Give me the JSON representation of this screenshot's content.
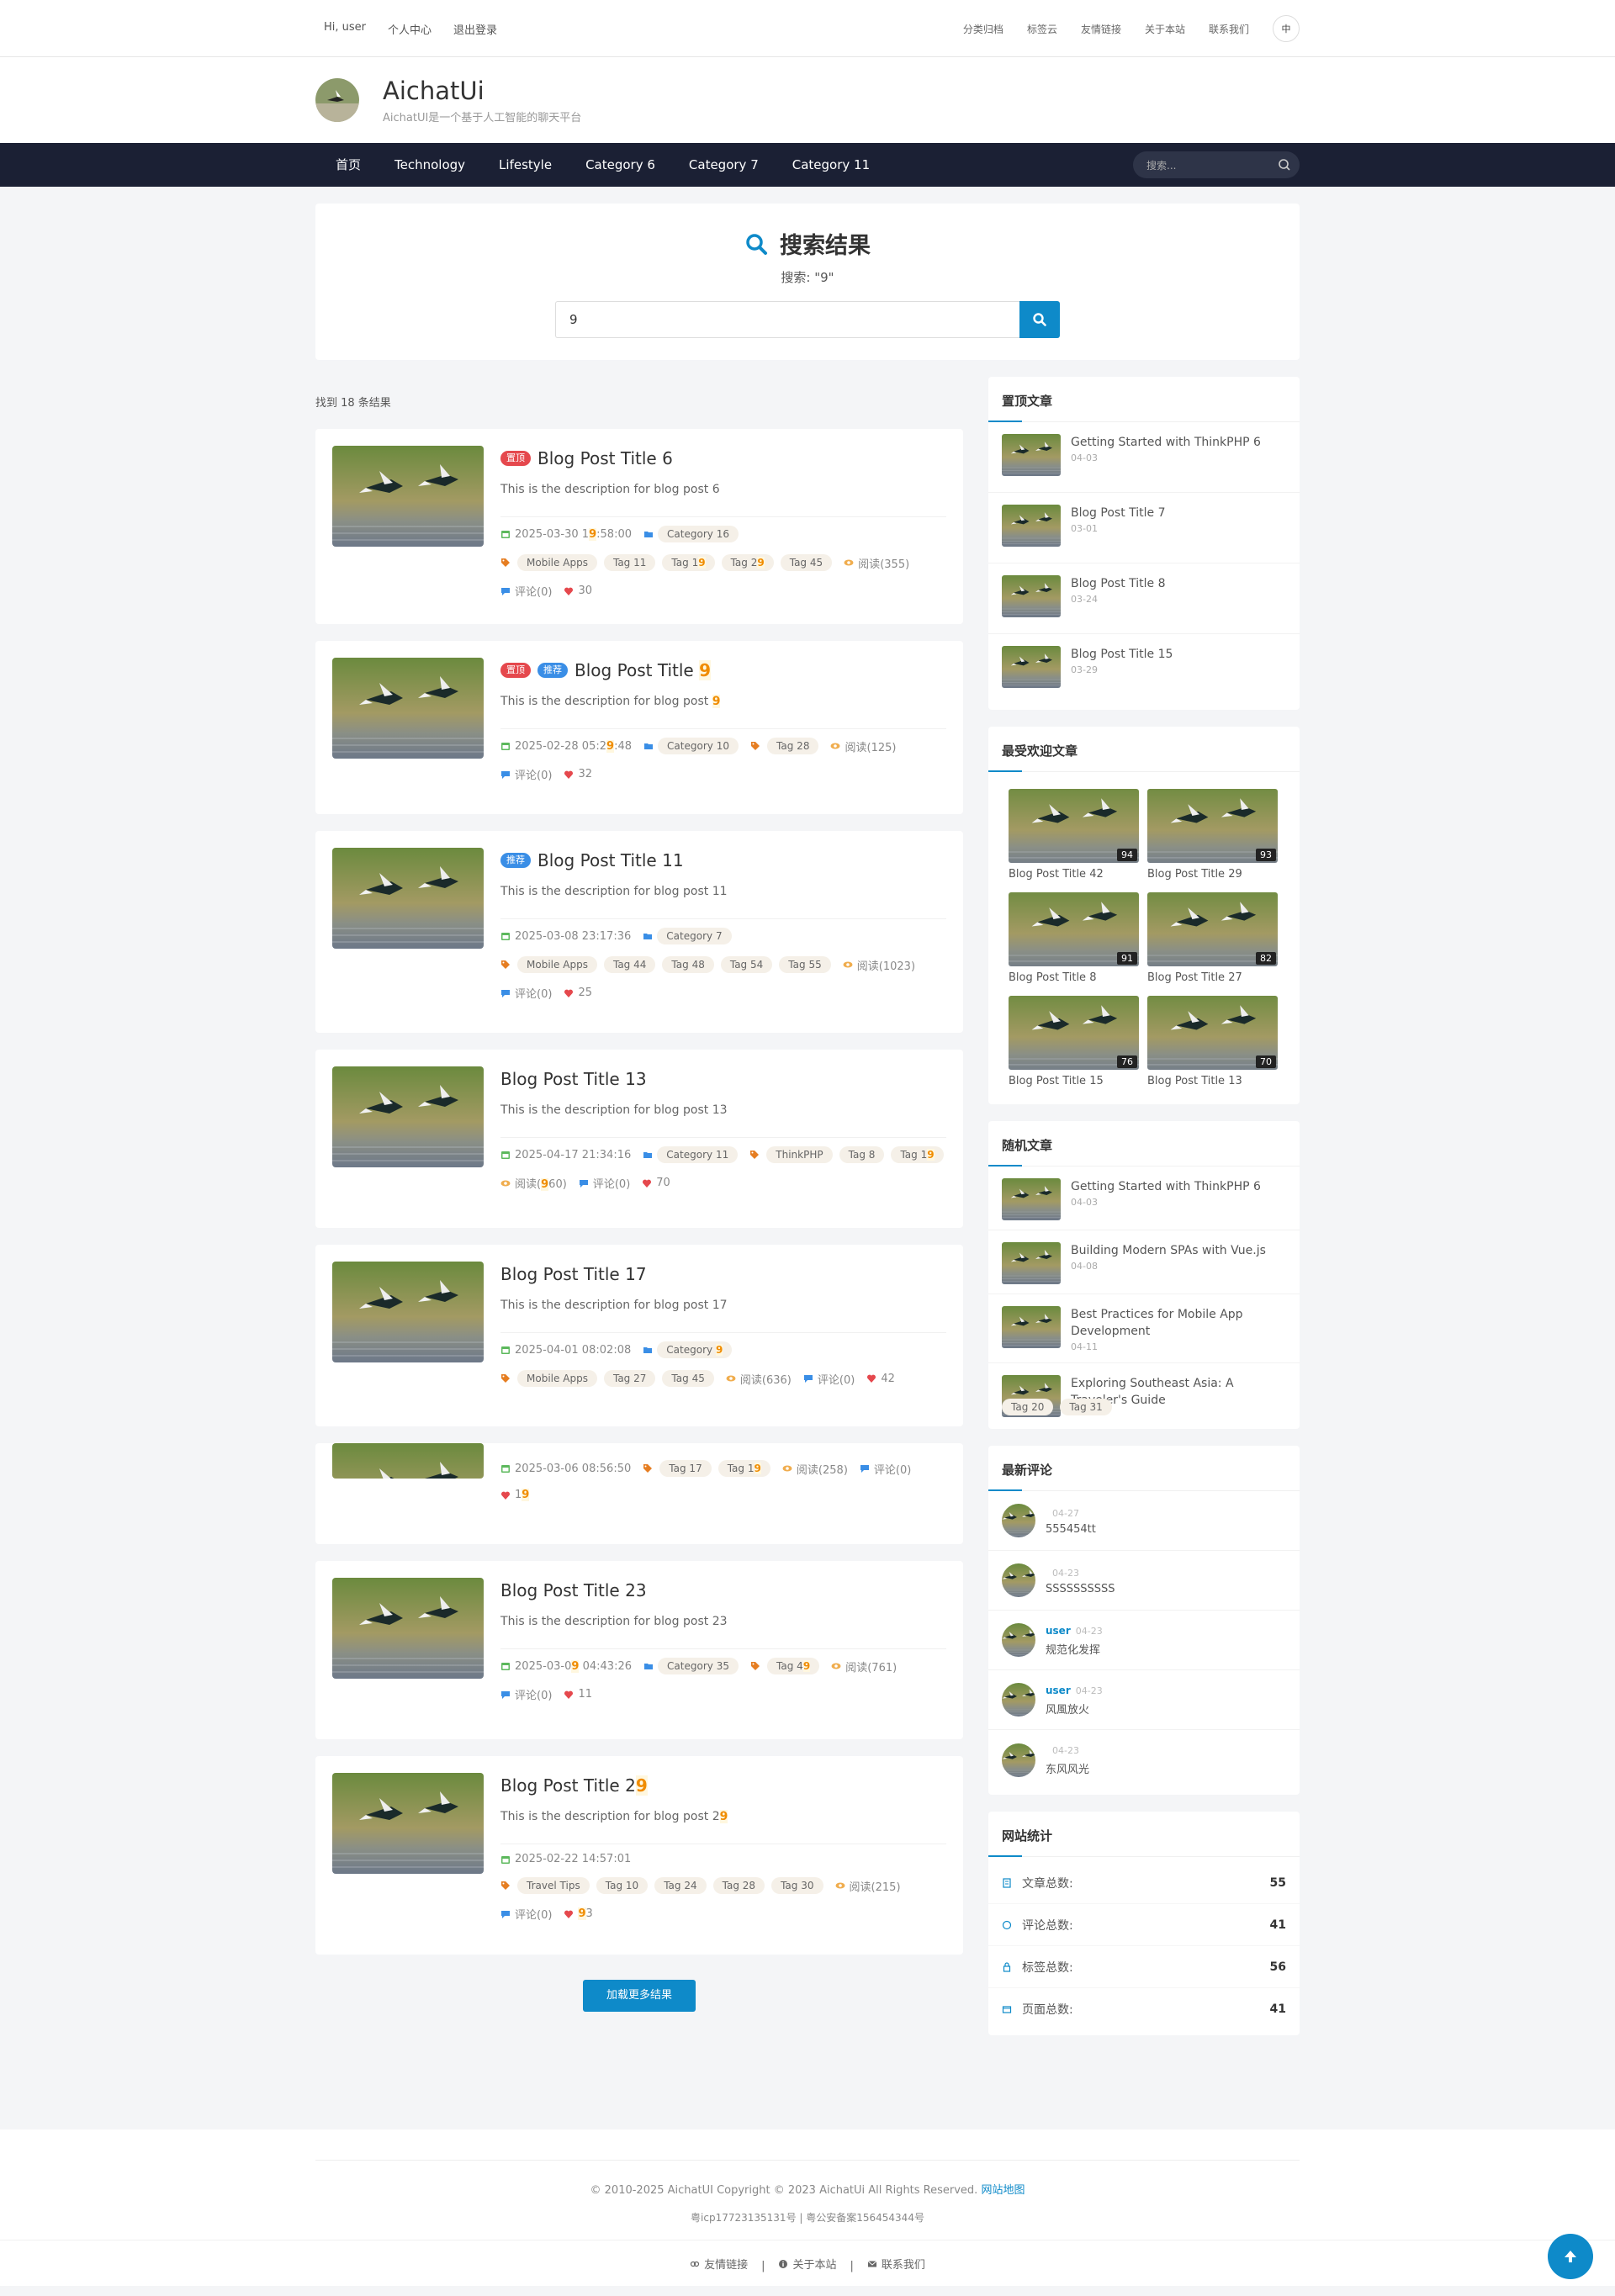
{
  "topbar": {
    "links": [
      "Hi, user",
      "个人中心",
      "退出登录"
    ],
    "right_links": [
      "分类归档",
      "标签云",
      "友情链接",
      "关于本站",
      "联系我们"
    ],
    "lang": "中"
  },
  "brand": {
    "title": "AichatUi",
    "desc": "AichatUI是一个基于人工智能的聊天平台"
  },
  "nav": {
    "items": [
      "首页",
      "Technology",
      "Lifestyle",
      "Category 6",
      "Category 7",
      "Category 11"
    ],
    "search_placeholder": "搜索..."
  },
  "search": {
    "heading": "搜索结果",
    "query_text": "搜索: \"9\"",
    "value": "9"
  },
  "results": {
    "found": "找到 18 条结果",
    "load_more": "加载更多结果"
  },
  "posts": [
    {
      "title": "Blog Post Title 6",
      "desc": "This is the description for blog post 6",
      "date": "2025-03-30 19:58:00",
      "category": "Category 16",
      "tags": [
        "Mobile Apps",
        "Tag 11",
        "Tag 19",
        "Tag 29",
        "Tag 45"
      ],
      "views": "阅读(355)",
      "comments": "评论(0)",
      "likes": "30",
      "badges": [
        "置顶"
      ]
    },
    {
      "title": "Blog Post Title 9",
      "desc": "This is the description for blog post 9",
      "date": "2025-02-28 05:29:48",
      "category": "Category 10",
      "tags": [
        "Tag 28"
      ],
      "views": "阅读(125)",
      "comments": "评论(0)",
      "likes": "32",
      "badges": [
        "置顶",
        "推荐"
      ]
    },
    {
      "title": "Blog Post Title 11",
      "desc": "This is the description for blog post 11",
      "date": "2025-03-08 23:17:36",
      "category": "Category 7",
      "tags": [
        "Mobile Apps",
        "Tag 44",
        "Tag 48",
        "Tag 54",
        "Tag 55"
      ],
      "views": "阅读(1023)",
      "comments": "评论(0)",
      "likes": "25",
      "badges": [
        "推荐"
      ]
    },
    {
      "title": "Blog Post Title 13",
      "desc": "This is the description for blog post 13",
      "date": "2025-04-17 21:34:16",
      "category": "Category 11",
      "tags": [
        "ThinkPHP",
        "Tag 8",
        "Tag 19"
      ],
      "views": "阅读(960)",
      "comments": "评论(0)",
      "likes": "70",
      "badges": []
    },
    {
      "title": "Blog Post Title 17",
      "desc": "This is the description for blog post 17",
      "date": "2025-04-01 08:02:08",
      "category": "Category 9",
      "tags": [
        "Mobile Apps",
        "Tag 27",
        "Tag 45"
      ],
      "views": "阅读(636)",
      "comments": "评论(0)",
      "likes": "42",
      "badges": []
    },
    {
      "title": "",
      "desc": "",
      "date": "2025-03-06 08:56:50",
      "category": "",
      "tags": [
        "Tag 17",
        "Tag 19"
      ],
      "views": "阅读(258)",
      "comments": "评论(0)",
      "likes": "19",
      "badges": []
    },
    {
      "title": "Blog Post Title 23",
      "desc": "This is the description for blog post 23",
      "date": "2025-03-09 04:43:26",
      "category": "Category 35",
      "tags": [
        "Tag 49"
      ],
      "views": "阅读(761)",
      "comments": "评论(0)",
      "likes": "11",
      "badges": []
    },
    {
      "title": "Blog Post Title 29",
      "desc": "This is the description for blog post 29",
      "date": "2025-02-22 14:57:01",
      "category": "",
      "tags": [
        "Travel Tips",
        "Tag 10",
        "Tag 24",
        "Tag 28",
        "Tag 30"
      ],
      "views": "阅读(215)",
      "comments": "评论(0)",
      "likes": "93",
      "badges": []
    }
  ],
  "sidebar": {
    "pinned": {
      "title": "置顶文章",
      "items": [
        {
          "t": "Getting Started with ThinkPHP 6",
          "d": "04-03"
        },
        {
          "t": "Blog Post Title 7",
          "d": "03-01"
        },
        {
          "t": "Blog Post Title 8",
          "d": "03-24"
        },
        {
          "t": "Blog Post Title 15",
          "d": "03-29"
        }
      ]
    },
    "popular": {
      "title": "最受欢迎文章",
      "items": [
        {
          "t": "Blog Post Title 42",
          "n": "94"
        },
        {
          "t": "Blog Post Title 29",
          "n": "93"
        },
        {
          "t": "Blog Post Title 8",
          "n": "91"
        },
        {
          "t": "Blog Post Title 27",
          "n": "82"
        },
        {
          "t": "Blog Post Title 15",
          "n": "76"
        },
        {
          "t": "Blog Post Title 13",
          "n": "70"
        }
      ]
    },
    "random": {
      "title": "随机文章",
      "items": [
        {
          "t": "Getting Started with ThinkPHP 6",
          "d": "04-03"
        },
        {
          "t": "Building Modern SPAs with Vue.js",
          "d": "04-08"
        },
        {
          "t": "Best Practices for Mobile App Development",
          "d": "04-11"
        },
        {
          "t": "Exploring Southeast Asia: A Traveler's Guide",
          "d": ""
        }
      ],
      "tags": [
        "Tag 20",
        "Tag 31"
      ]
    },
    "comments": {
      "title": "最新评论",
      "items": [
        {
          "u": "",
          "d": "04-27",
          "t": "555454tt"
        },
        {
          "u": "",
          "d": "04-23",
          "t": "SSSSSSSSSS"
        },
        {
          "u": "user",
          "d": "04-23",
          "t": "规范化发挥"
        },
        {
          "u": "user",
          "d": "04-23",
          "t": "风風放火"
        },
        {
          "u": "",
          "d": "04-23",
          "t": "东风风光"
        }
      ]
    },
    "stats": {
      "title": "网站统计",
      "items": [
        {
          "k": "文章总数:",
          "v": "55"
        },
        {
          "k": "评论总数:",
          "v": "41"
        },
        {
          "k": "标签总数:",
          "v": "56"
        },
        {
          "k": "页面总数:",
          "v": "41"
        }
      ]
    }
  },
  "footer": {
    "copyright": "© 2010-2025 AichatUI Copyright © 2023 AichatUi All Rights Reserved.",
    "sitemap": "网站地图",
    "icp": "粤icp17723135131号 | 粤公安备案156454344号",
    "links": [
      "友情链接",
      "关于本站",
      "联系我们"
    ]
  },
  "colors": {
    "accent": "#0e8ac9",
    "nav_bg": "#1b2034",
    "highlight": "#f08c00"
  }
}
